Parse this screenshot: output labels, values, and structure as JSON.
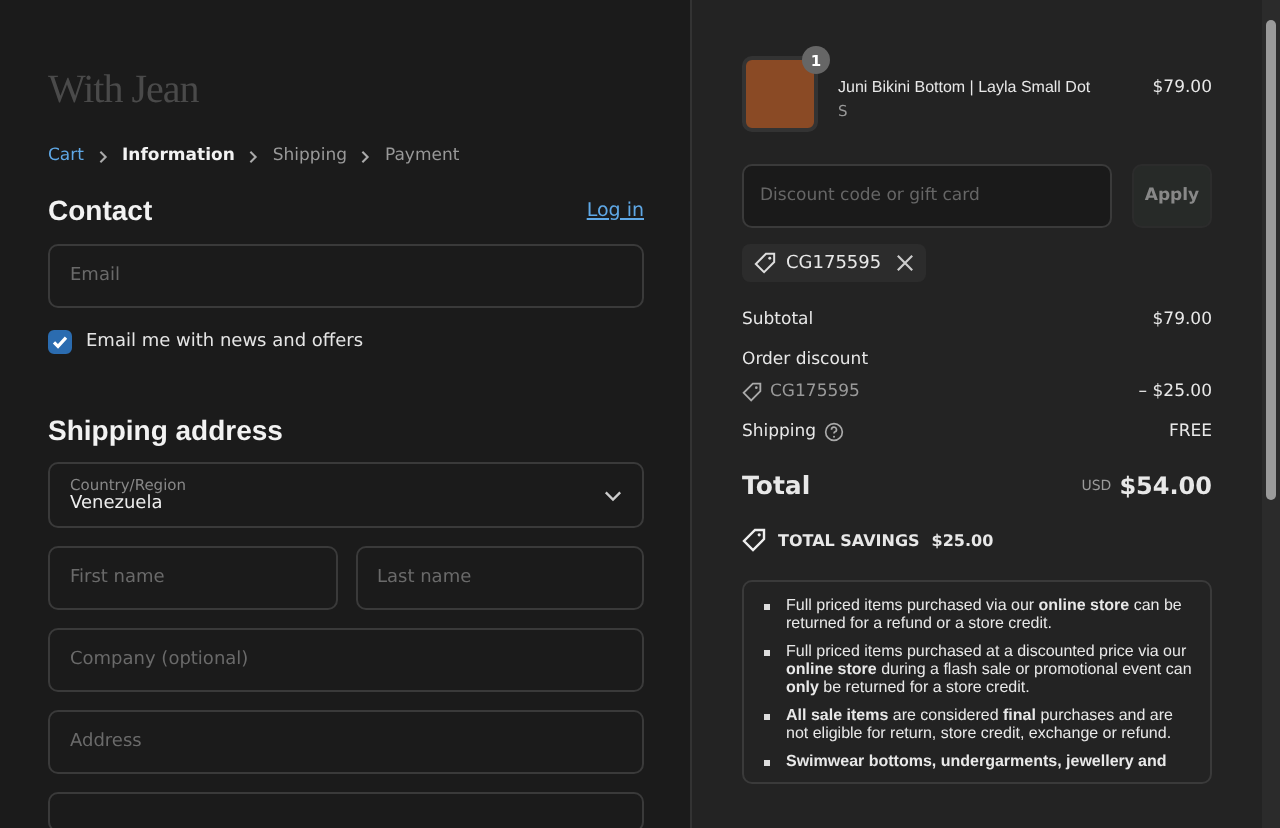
{
  "logo": "With Jean",
  "breadcrumbs": [
    {
      "label": "Cart",
      "selected": false,
      "link": true
    },
    {
      "label": "Information",
      "selected": true,
      "link": false
    },
    {
      "label": "Shipping",
      "selected": false,
      "link": false
    },
    {
      "label": "Payment",
      "selected": false,
      "link": false
    }
  ],
  "contact": {
    "heading": "Contact",
    "login_link": "Log in",
    "email": {
      "placeholder": "Email"
    },
    "newsletter": {
      "label": "Email me with news and offers",
      "checked": true
    }
  },
  "shipping_address": {
    "heading": "Shipping address",
    "country": {
      "label": "Country/Region",
      "value": "Venezuela"
    },
    "fields": [
      {
        "placeholder": "First name",
        "half": true
      },
      {
        "placeholder": "Last name",
        "half": true
      },
      {
        "placeholder": "Company (optional)",
        "half": false
      },
      {
        "placeholder": "Address",
        "half": false
      }
    ]
  },
  "order": {
    "item": {
      "quantity": "1",
      "name": "Juni Bikini Bottom | Layla Small Dot",
      "variant": "S",
      "price": "$79.00"
    },
    "discount": {
      "placeholder": "Discount code or gift card",
      "button": "Apply",
      "applied_code": "CG175595"
    },
    "subtotal": {
      "label": "Subtotal",
      "value": "$79.00"
    },
    "order_discount": {
      "label": "Order discount",
      "code": "CG175595",
      "value": "– $25.00"
    },
    "shipping": {
      "label": "Shipping",
      "value": "FREE"
    },
    "total": {
      "label": "Total",
      "currency": "USD",
      "value": "$54.00"
    },
    "savings": {
      "label": "TOTAL SAVINGS",
      "value": "$25.00"
    },
    "policy": [
      "Full priced items purchased via our **online store** can be returned for a refund or a store credit.",
      "Full priced items purchased at a discounted price via our **online store** during a flash sale or promotional event can **only** be returned for a store credit.",
      "**All sale items** are considered **final** purchases and are not eligible for return, store credit, exchange or refund.",
      "**Swimwear bottoms, undergarments, jewellery and**"
    ]
  }
}
